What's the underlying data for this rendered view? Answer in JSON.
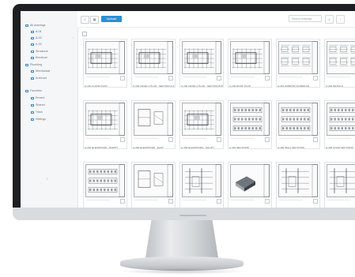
{
  "sidebar": {
    "items": [
      {
        "label": "All drawings",
        "level": 0,
        "active": false
      },
      {
        "label": "A-01",
        "level": 1,
        "active": true
      },
      {
        "label": "A-02",
        "level": 1,
        "active": false
      },
      {
        "label": "A-03",
        "level": 1,
        "active": false
      },
      {
        "label": "Structural",
        "level": 1,
        "active": false
      },
      {
        "label": "Electrical",
        "level": 1,
        "active": false
      },
      {
        "label": "Plumbing",
        "level": 0,
        "active": false
      },
      {
        "label": "Mechanical",
        "level": 1,
        "active": false
      },
      {
        "label": "Archived",
        "level": 1,
        "active": false
      },
      {
        "label": "Favorites",
        "level": 0,
        "active": false
      },
      {
        "label": "Recent",
        "level": 1,
        "active": false
      },
      {
        "label": "Shared",
        "level": 1,
        "active": false
      },
      {
        "label": "Trash",
        "level": 1,
        "active": false
      },
      {
        "label": "Settings",
        "level": 1,
        "active": false
      }
    ],
    "chevron": "›",
    "collapse_arrow": "›"
  },
  "toolbar": {
    "view_list_icon": "list-icon",
    "view_grid_icon": "grid-icon",
    "upload_label": "Upload",
    "search_placeholder": "Search drawings",
    "search_icon": "search-icon",
    "more_icon": "more-icon"
  },
  "drawings": [
    {
      "caption": "A-101 FLOOR PLAN",
      "kind": "plan"
    },
    {
      "caption": "A-102 LEVEL 1 PLAN - SECTION A-A",
      "kind": "plan"
    },
    {
      "caption": "A-103 LEVEL 2 PLAN - SECTION B-B",
      "kind": "plan"
    },
    {
      "caption": "A-104 ROOF PLAN",
      "kind": "plan"
    },
    {
      "caption": "A-201 WINDOW SCHEDULE",
      "kind": "schedule"
    },
    {
      "caption": "A-202 DETAILS",
      "kind": "schedule"
    },
    {
      "caption": "A-301 ELEVATIONS - NORTH",
      "kind": "plan"
    },
    {
      "caption": "A-302 ELEVATIONS - EAST",
      "kind": "detail"
    },
    {
      "caption": "A-303 ELEVATIONS - SOUTH",
      "kind": "plan"
    },
    {
      "caption": "A-401 SECTIONS",
      "kind": "elevation"
    },
    {
      "caption": "A-402 WALL SECTIONS",
      "kind": "elevation"
    },
    {
      "caption": "A-403 STAIR SECTIONS",
      "kind": "elevation"
    },
    {
      "caption": "S-101 FOUNDATION PLAN",
      "kind": "elevation"
    },
    {
      "caption": "S-102 FRAMING PLAN",
      "kind": "detail"
    },
    {
      "caption": "S-201 DETAILS",
      "kind": "section"
    },
    {
      "caption": "M-101 MECHANICAL 3D",
      "kind": "iso"
    },
    {
      "caption": "M-102 DUCTWORK 3D",
      "kind": "section"
    },
    {
      "caption": "M-103 PIPING 3D",
      "kind": "section"
    }
  ],
  "colors": {
    "accent": "#2d8fd5",
    "sidebar_bg": "#f4f6f8",
    "bezel": "#1e1f22",
    "line": "#3d4248"
  }
}
